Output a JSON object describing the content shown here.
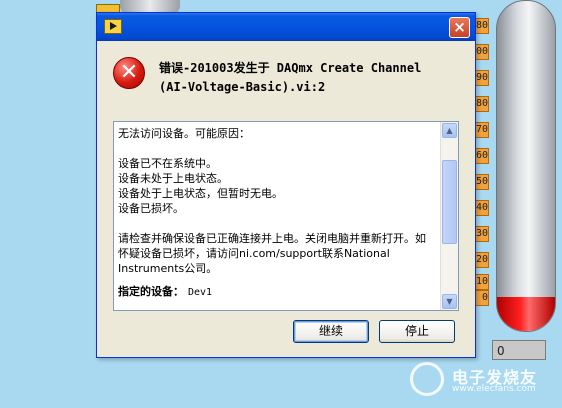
{
  "background": {
    "gauge_ticks": [
      "80",
      "00",
      "90",
      "80",
      "70",
      "60",
      "50",
      "40",
      "30",
      "20",
      "10",
      "0"
    ],
    "readout_value": "0",
    "watermark": {
      "line1": "电子发烧友",
      "line2": "www.elecfans.com"
    }
  },
  "dialog": {
    "close_label": "×",
    "error_icon_symbol": "✕",
    "error_title_line1": "错误-201003发生于 DAQmx Create Channel",
    "error_title_line2": "(AI-Voltage-Basic).vi:2",
    "message": {
      "intro": "无法访问设备。可能原因：",
      "causes": [
        "设备已不在系统中。",
        "设备未处于上电状态。",
        "设备处于上电状态，但暂时无电。",
        "设备已损坏。"
      ],
      "advice": "请检查并确保设备已正确连接并上电。关闭电脑并重新打开。如怀疑设备已损坏，请访问ni.com/support联系National Instruments公司。",
      "device_label": "指定的设备：",
      "device_value": "Dev1"
    },
    "buttons": {
      "continue": "继续",
      "stop": "停止"
    }
  },
  "colors": {
    "panel_bg": "#a9d9f0",
    "titlebar": "#0454e0",
    "error_red": "#d81a10",
    "dialog_face": "#ece9d8"
  }
}
